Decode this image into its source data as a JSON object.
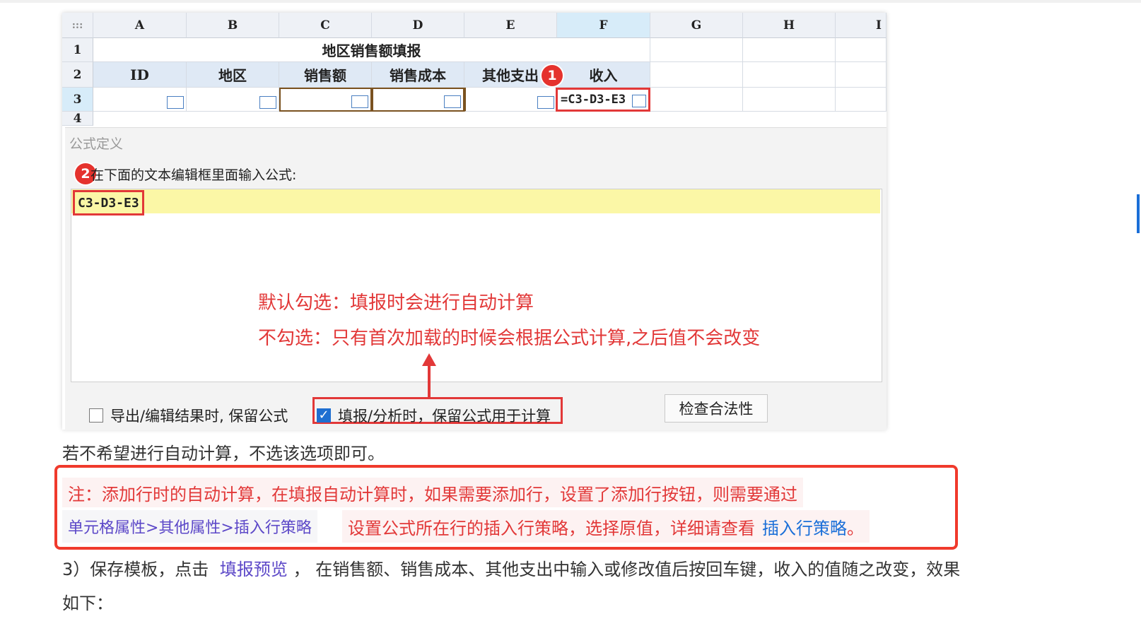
{
  "sheet": {
    "corner": ":::",
    "columns": [
      "A",
      "B",
      "C",
      "D",
      "E",
      "F",
      "G",
      "H",
      "I"
    ],
    "rows": [
      "1",
      "2",
      "3",
      "4"
    ],
    "title": "地区销售额填报",
    "headers": [
      "ID",
      "地区",
      "销售额",
      "销售成本",
      "其他支出",
      "收入"
    ],
    "f3_formula": "=C3-D3-E3",
    "badge1": "1"
  },
  "dialog": {
    "title": "公式定义",
    "badge2": "2",
    "prompt": "在下面的文本编辑框里面输入公式:",
    "formula": "C3-D3-E3",
    "note_default": "默认勾选：填报时会进行自动计算",
    "note_unchecked": "不勾选：只有首次加载的时候会根据公式计算,之后值不会改变",
    "checkbox_export": "导出/编辑结果时, 保留公式",
    "checkbox_fill": "填报/分析时，保留公式用于计算",
    "check_button": "检查合法性"
  },
  "article": {
    "p1": "若不希望进行自动计算，不选该选项即可。",
    "note_line1": "注：添加行时的自动计算，在填报自动计算时，如果需要添加行，设置了添加行按钮，则需要通过",
    "note_pill": "单元格属性>其他属性>插入行策略",
    "note_line2_text": "设置公式所在行的插入行策略，选择原值，详细请查看",
    "note_line2_link": "插入行策略",
    "note_line2_end": "。",
    "p3_prefix": "3）保存模板，点击",
    "p3_link": "填报预览",
    "p3_suffix": "，  在销售额、销售成本、其他支出中输入或修改值后按回车键，收入的值随之改变，效果",
    "p3_line2": "如下："
  },
  "colors": {
    "accent_red": "#e23838",
    "link_blue": "#1a6fd8",
    "link_purple": "#5c48c8",
    "highlight_yellow": "#fbf7a6"
  }
}
